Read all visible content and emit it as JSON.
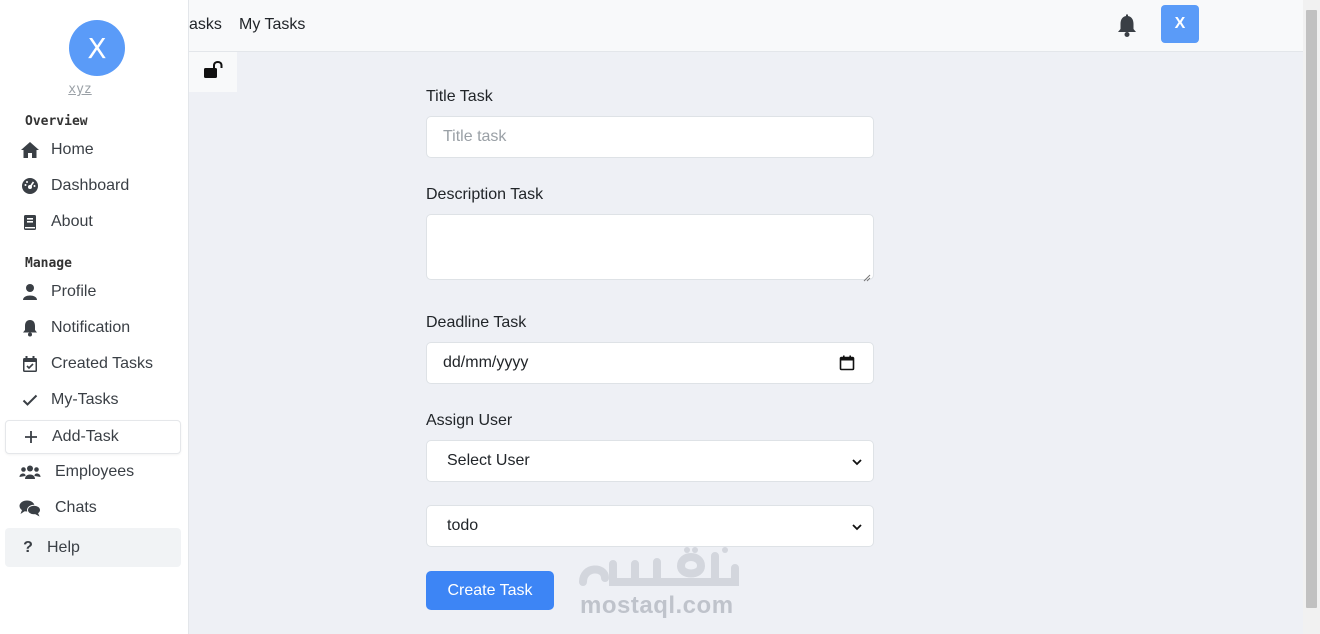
{
  "sidebar": {
    "avatar_letter": "X",
    "username": "xyz",
    "sections": {
      "overview": "Overview",
      "manage": "Manage"
    },
    "items": [
      {
        "label": "Home",
        "icon": "home-icon"
      },
      {
        "label": "Dashboard",
        "icon": "gauge-icon"
      },
      {
        "label": "About",
        "icon": "book-icon"
      },
      {
        "label": "Profile",
        "icon": "user-icon"
      },
      {
        "label": "Notification",
        "icon": "bell-icon"
      },
      {
        "label": "Created Tasks",
        "icon": "calendar-check-icon"
      },
      {
        "label": "My-Tasks",
        "icon": "check-icon"
      },
      {
        "label": "Add-Task",
        "icon": "plus-icon"
      },
      {
        "label": "Employees",
        "icon": "users-icon"
      },
      {
        "label": "Chats",
        "icon": "comments-icon"
      },
      {
        "label": "Help",
        "icon": "question-icon"
      }
    ]
  },
  "topbar": {
    "link_tasks": "asks",
    "link_my_tasks": "My Tasks",
    "avatar_letter": "X"
  },
  "form": {
    "title_label": "Title Task",
    "title_placeholder": "Title task",
    "description_label": "Description Task",
    "deadline_label": "Deadline Task",
    "deadline_value": "dd/mm/yyyy",
    "assign_label": "Assign User",
    "assign_selected": "Select User",
    "status_selected": "todo",
    "submit_label": "Create Task"
  },
  "watermark": {
    "text": "mostaql.com"
  },
  "colors": {
    "accent": "#3d85f5",
    "avatar": "#5a9bf8",
    "background": "#eef0f5"
  }
}
